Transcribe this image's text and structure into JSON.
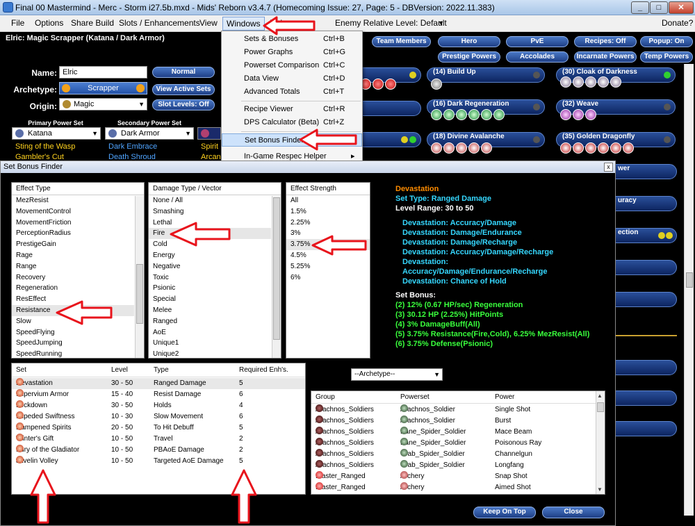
{
  "window": {
    "title": "Final 00 Mastermind - Merc - Storm i27.5b.mxd - Mids' Reborn v3.4.7  (Homecoming Issue: 27, Page: 5 - DBVersion: 2022.11.383)"
  },
  "menubar": {
    "items": [
      "File",
      "Options",
      "Share Build",
      "Slots / Enhancements",
      "View",
      "Windows",
      "Help"
    ],
    "enemy_level": "Enemy Relative Level: Default",
    "donate": "Donate?"
  },
  "build": {
    "header": "Elric: Magic Scrapper (Katana / Dark Armor)",
    "name_label": "Name:",
    "name_value": "Elric",
    "archetype_label": "Archetype:",
    "archetype_value": "Scrapper",
    "origin_label": "Origin:",
    "origin_value": "Magic",
    "primary_label": "Primary Power Set",
    "secondary_label": "Secondary Power Set",
    "primary_value": "Katana",
    "secondary_value": "Dark Armor",
    "primary_powers": [
      "Sting of the Wasp",
      "Gambler's Cut"
    ],
    "secondary_powers": [
      "Dark Embrace",
      "Death Shroud"
    ],
    "pool_powers": [
      "Spirit",
      "Arcan"
    ],
    "buttons": {
      "normal": "Normal",
      "view_active": "View Active Sets",
      "slot_levels": "Slot Levels: Off"
    }
  },
  "top_buttons": [
    "Team Members",
    "Hero",
    "PvE",
    "Recipes: Off",
    "Popup: On",
    "Prestige Powers",
    "Accolades",
    "Incarnate Powers",
    "Temp Powers"
  ],
  "powers": [
    {
      "label": "(14) Build Up",
      "slots": []
    },
    {
      "label": "(30) Cloak of Darkness",
      "slots": [
        "50",
        "50",
        "50",
        "50",
        "50"
      ]
    },
    {
      "label": "(16) Dark Regeneration",
      "slots": [
        "50",
        "50",
        "50",
        "50",
        "50",
        "30"
      ]
    },
    {
      "label": "(32) Weave",
      "slots": [
        "50",
        "50",
        "50"
      ]
    },
    {
      "label": "(18) Divine Avalanche",
      "slots": [
        "50",
        "50",
        "50",
        "50",
        "50"
      ]
    },
    {
      "label": "(35) Golden Dragonfly",
      "slots": [
        "30",
        "30",
        "30",
        "30",
        "30",
        "30"
      ]
    }
  ],
  "right_partials": [
    "wer",
    "uracy",
    "ection"
  ],
  "dropdown": {
    "items": [
      {
        "label": "Sets & Bonuses",
        "shortcut": "Ctrl+B"
      },
      {
        "label": "Power Graphs",
        "shortcut": "Ctrl+G"
      },
      {
        "label": "Powerset Comparison",
        "shortcut": "Ctrl+C"
      },
      {
        "label": "Data View",
        "shortcut": "Ctrl+D"
      },
      {
        "label": "Advanced Totals",
        "shortcut": "Ctrl+T"
      },
      {
        "label": "Recipe Viewer",
        "shortcut": "Ctrl+R"
      },
      {
        "label": "DPS Calculator (Beta)",
        "shortcut": "Ctrl+Z"
      },
      {
        "label": "Set Bonus Finder",
        "shortcut": ""
      },
      {
        "label": "In-Game Respec Helper",
        "shortcut": ""
      }
    ]
  },
  "finder": {
    "title": "Set Bonus Finder",
    "close": "x",
    "effect_header": "Effect Type",
    "effect_types": [
      "MezResist",
      "MovementControl",
      "MovementFriction",
      "PerceptionRadius",
      "PrestigeGain",
      "Rage",
      "Range",
      "Recovery",
      "Regeneration",
      "ResEffect",
      "Resistance",
      "Slow",
      "SpeedFlying",
      "SpeedJumping",
      "SpeedRunning"
    ],
    "damage_header": "Damage Type / Vector",
    "damage_types": [
      "None / All",
      "Smashing",
      "Lethal",
      "Fire",
      "Cold",
      "Energy",
      "Negative",
      "Toxic",
      "Psionic",
      "Special",
      "Melee",
      "Ranged",
      "AoE",
      "Unique1",
      "Unique2"
    ],
    "strength_header": "Effect Strength",
    "strengths": [
      "All",
      "1.5%",
      "2.25%",
      "3%",
      "3.75%",
      "4.5%",
      "5.25%",
      "6%"
    ],
    "set_name": "Devastation",
    "set_type": "Set Type: Ranged Damage",
    "level_range": "Level Range: 30 to 50",
    "enhancements": [
      "Devastation: Accuracy/Damage",
      "Devastation: Damage/Endurance",
      "Devastation: Damage/Recharge",
      "Devastation: Accuracy/Damage/Recharge",
      "Devastation:",
      "Accuracy/Damage/Endurance/Recharge",
      "Devastation: Chance of Hold"
    ],
    "bonus_header": "Set Bonus:",
    "bonuses": [
      "(2) 12% (0.67 HP/sec) Regeneration",
      "(3) 30.12 HP (2.25%) HitPoints",
      "(4) 3% DamageBuff(All)",
      "(5) 3.75% Resistance(Fire,Cold), 6.25% MezResist(All)",
      "(6) 3.75% Defense(Psionic)"
    ],
    "sets_columns": [
      "Set",
      "Level",
      "Type",
      "Required Enh's."
    ],
    "sets": [
      {
        "set": "Devastation",
        "level": "30 - 50",
        "type": "Ranged Damage",
        "req": "5"
      },
      {
        "set": "Impervium Armor",
        "level": "15 - 40",
        "type": "Resist Damage",
        "req": "6"
      },
      {
        "set": "Lockdown",
        "level": "30 - 50",
        "type": "Holds",
        "req": "4"
      },
      {
        "set": "Impeded Swiftness",
        "level": "10 - 30",
        "type": "Slow Movement",
        "req": "6"
      },
      {
        "set": "Dampened Spirits",
        "level": "20 - 50",
        "type": "To Hit Debuff",
        "req": "5"
      },
      {
        "set": "Winter's Gift",
        "level": "10 - 50",
        "type": "Travel",
        "req": "2"
      },
      {
        "set": "Fury of the Gladiator",
        "level": "10 - 50",
        "type": "PBAoE Damage",
        "req": "2"
      },
      {
        "set": "Javelin Volley",
        "level": "10 - 50",
        "type": "Targeted AoE Damage",
        "req": "5"
      }
    ],
    "archetype_select": "--Archetype--",
    "power_columns": [
      "Group",
      "Powerset",
      "Power"
    ],
    "power_rows": [
      {
        "group": "Arachnos_Soldiers",
        "powerset": "Arachnos_Soldier",
        "power": "Single Shot"
      },
      {
        "group": "Arachnos_Soldiers",
        "powerset": "Arachnos_Soldier",
        "power": "Burst"
      },
      {
        "group": "Arachnos_Soldiers",
        "powerset": "Bane_Spider_Soldier",
        "power": "Mace Beam"
      },
      {
        "group": "Arachnos_Soldiers",
        "powerset": "Bane_Spider_Soldier",
        "power": "Poisonous Ray"
      },
      {
        "group": "Arachnos_Soldiers",
        "powerset": "Crab_Spider_Soldier",
        "power": "Channelgun"
      },
      {
        "group": "Arachnos_Soldiers",
        "powerset": "Crab_Spider_Soldier",
        "power": "Longfang"
      },
      {
        "group": "Blaster_Ranged",
        "powerset": "Archery",
        "power": "Snap Shot"
      },
      {
        "group": "Blaster_Ranged",
        "powerset": "Archery",
        "power": "Aimed Shot"
      }
    ],
    "keep_on_top": "Keep On Top",
    "close_btn": "Close"
  },
  "colors": {
    "accent_red": "#e8141c",
    "set_name": "#ff8c00",
    "set_type": "#35d7ff",
    "enh_text": "#35d7ff",
    "bonus_text": "#39ff3c"
  }
}
